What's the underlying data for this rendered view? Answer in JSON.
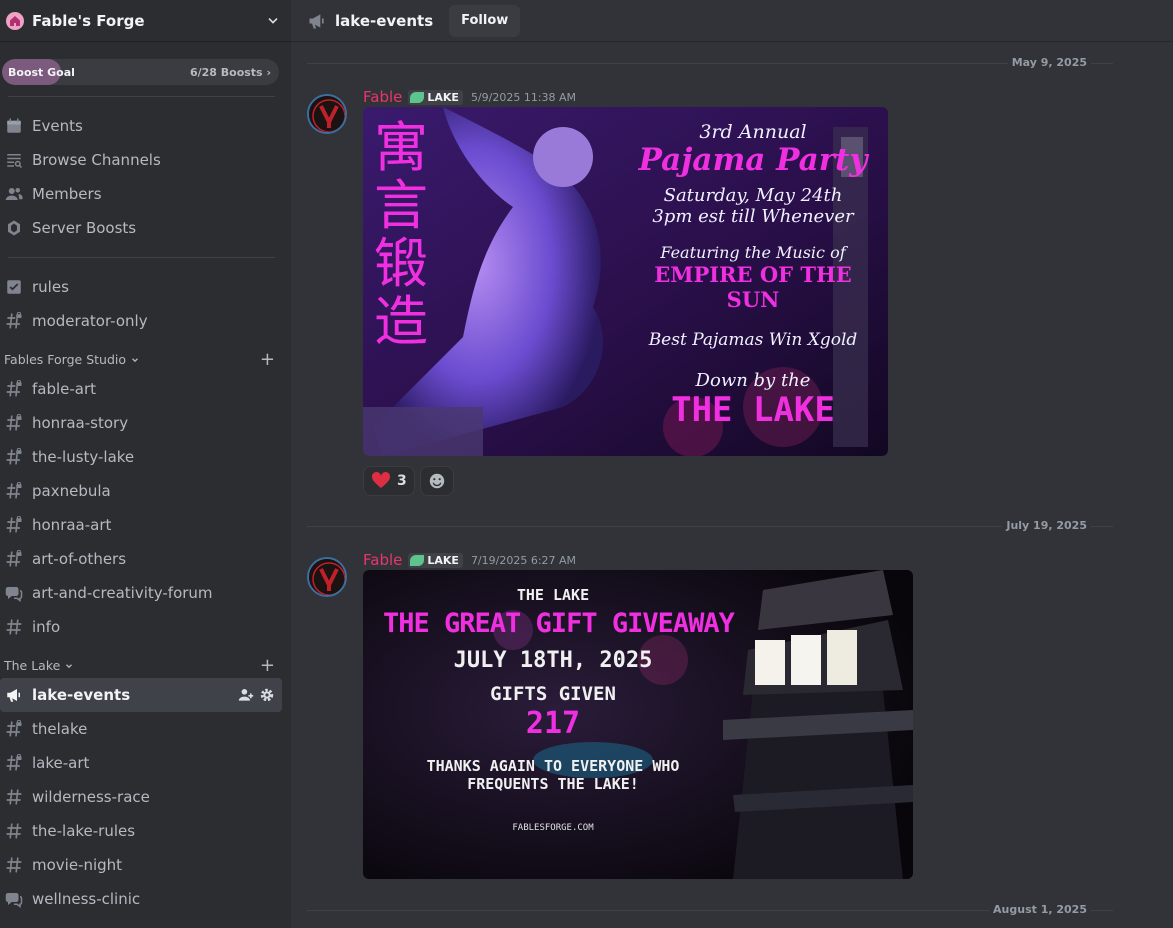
{
  "server": {
    "name": "Fable's Forge"
  },
  "boost": {
    "label": "Boost Goal",
    "count": "6/28 Boosts",
    "progress": 0.214
  },
  "top_nav": [
    {
      "label": "Events",
      "icon": "calendar-icon"
    },
    {
      "label": "Browse Channels",
      "icon": "browse-channels-icon"
    },
    {
      "label": "Members",
      "icon": "members-icon"
    },
    {
      "label": "Server Boosts",
      "icon": "boost-gem-icon"
    }
  ],
  "channels_top": [
    {
      "label": "rules",
      "icon": "rules-icon"
    },
    {
      "label": "moderator-only",
      "icon": "locked-hash-icon"
    }
  ],
  "category_studio": {
    "label": "Fables Forge Studio",
    "channels": [
      {
        "label": "fable-art",
        "icon": "locked-hash-icon"
      },
      {
        "label": "honraa-story",
        "icon": "locked-hash-icon"
      },
      {
        "label": "the-lusty-lake",
        "icon": "locked-hash-icon"
      },
      {
        "label": "paxnebula",
        "icon": "locked-hash-icon"
      },
      {
        "label": "honraa-art",
        "icon": "locked-hash-icon"
      },
      {
        "label": "art-of-others",
        "icon": "locked-hash-icon"
      },
      {
        "label": "art-and-creativity-forum",
        "icon": "forum-icon"
      },
      {
        "label": "info",
        "icon": "hash-icon"
      }
    ]
  },
  "category_lake": {
    "label": "The Lake",
    "channels": [
      {
        "label": "lake-events",
        "icon": "announcement-icon",
        "active": true
      },
      {
        "label": "thelake",
        "icon": "locked-hash-icon"
      },
      {
        "label": "lake-art",
        "icon": "locked-hash-icon"
      },
      {
        "label": "wilderness-race",
        "icon": "hash-icon"
      },
      {
        "label": "the-lake-rules",
        "icon": "hash-icon"
      },
      {
        "label": "movie-night",
        "icon": "hash-icon"
      },
      {
        "label": "wellness-clinic",
        "icon": "forum-icon"
      }
    ]
  },
  "header": {
    "channel": "lake-events",
    "follow_label": "Follow"
  },
  "dates": [
    "May 9, 2025",
    "July 19, 2025",
    "August 1, 2025"
  ],
  "messages": [
    {
      "author": "Fable",
      "tag": "LAKE",
      "timestamp": "5/9/2025 11:38 AM",
      "image": {
        "side_text": [
          "寓",
          "言",
          "锻",
          "造"
        ],
        "lines": [
          "3rd Annual",
          "Pajama Party",
          "Saturday, May 24th",
          "3pm est till Whenever",
          "Featuring the Music of",
          "EMPIRE OF THE SUN",
          "Best Pajamas Win Xgold",
          "Down by the",
          "THE LAKE"
        ]
      },
      "reactions": [
        {
          "emoji": "heart-icon",
          "count": "3"
        }
      ]
    },
    {
      "author": "Fable",
      "tag": "LAKE",
      "timestamp": "7/19/2025 6:27 AM",
      "image": {
        "lines": [
          "THE LAKE",
          "THE GREAT GIFT GIVEAWAY",
          "JULY 18TH, 2025",
          "GIFTS GIVEN",
          "217",
          "THANKS AGAIN TO EVERYONE WHO",
          "FREQUENTS THE LAKE!",
          "FABLESFORGE.COM"
        ]
      }
    }
  ],
  "colors": {
    "accent_author": "#e8356b",
    "poster_pink": "#f030e0",
    "bg": "#313338",
    "sidebar": "#2b2d31"
  }
}
